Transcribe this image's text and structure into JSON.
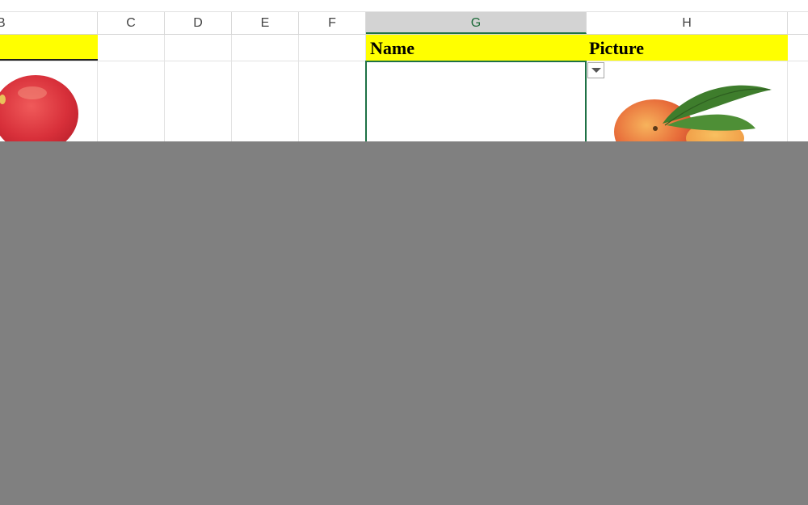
{
  "column_headers": {
    "b": "B",
    "c": "C",
    "d": "D",
    "e": "E",
    "f": "F",
    "g": "G",
    "h": "H"
  },
  "table": {
    "name_header": "Name",
    "picture_header": "Picture"
  },
  "images": {
    "left_fruit": "apple",
    "right_fruit": "peach"
  },
  "colors": {
    "header_fill": "#ffff00",
    "selection_border": "#1e7145",
    "selected_column_header": "#d3d3d3",
    "overlay": "#808080"
  }
}
